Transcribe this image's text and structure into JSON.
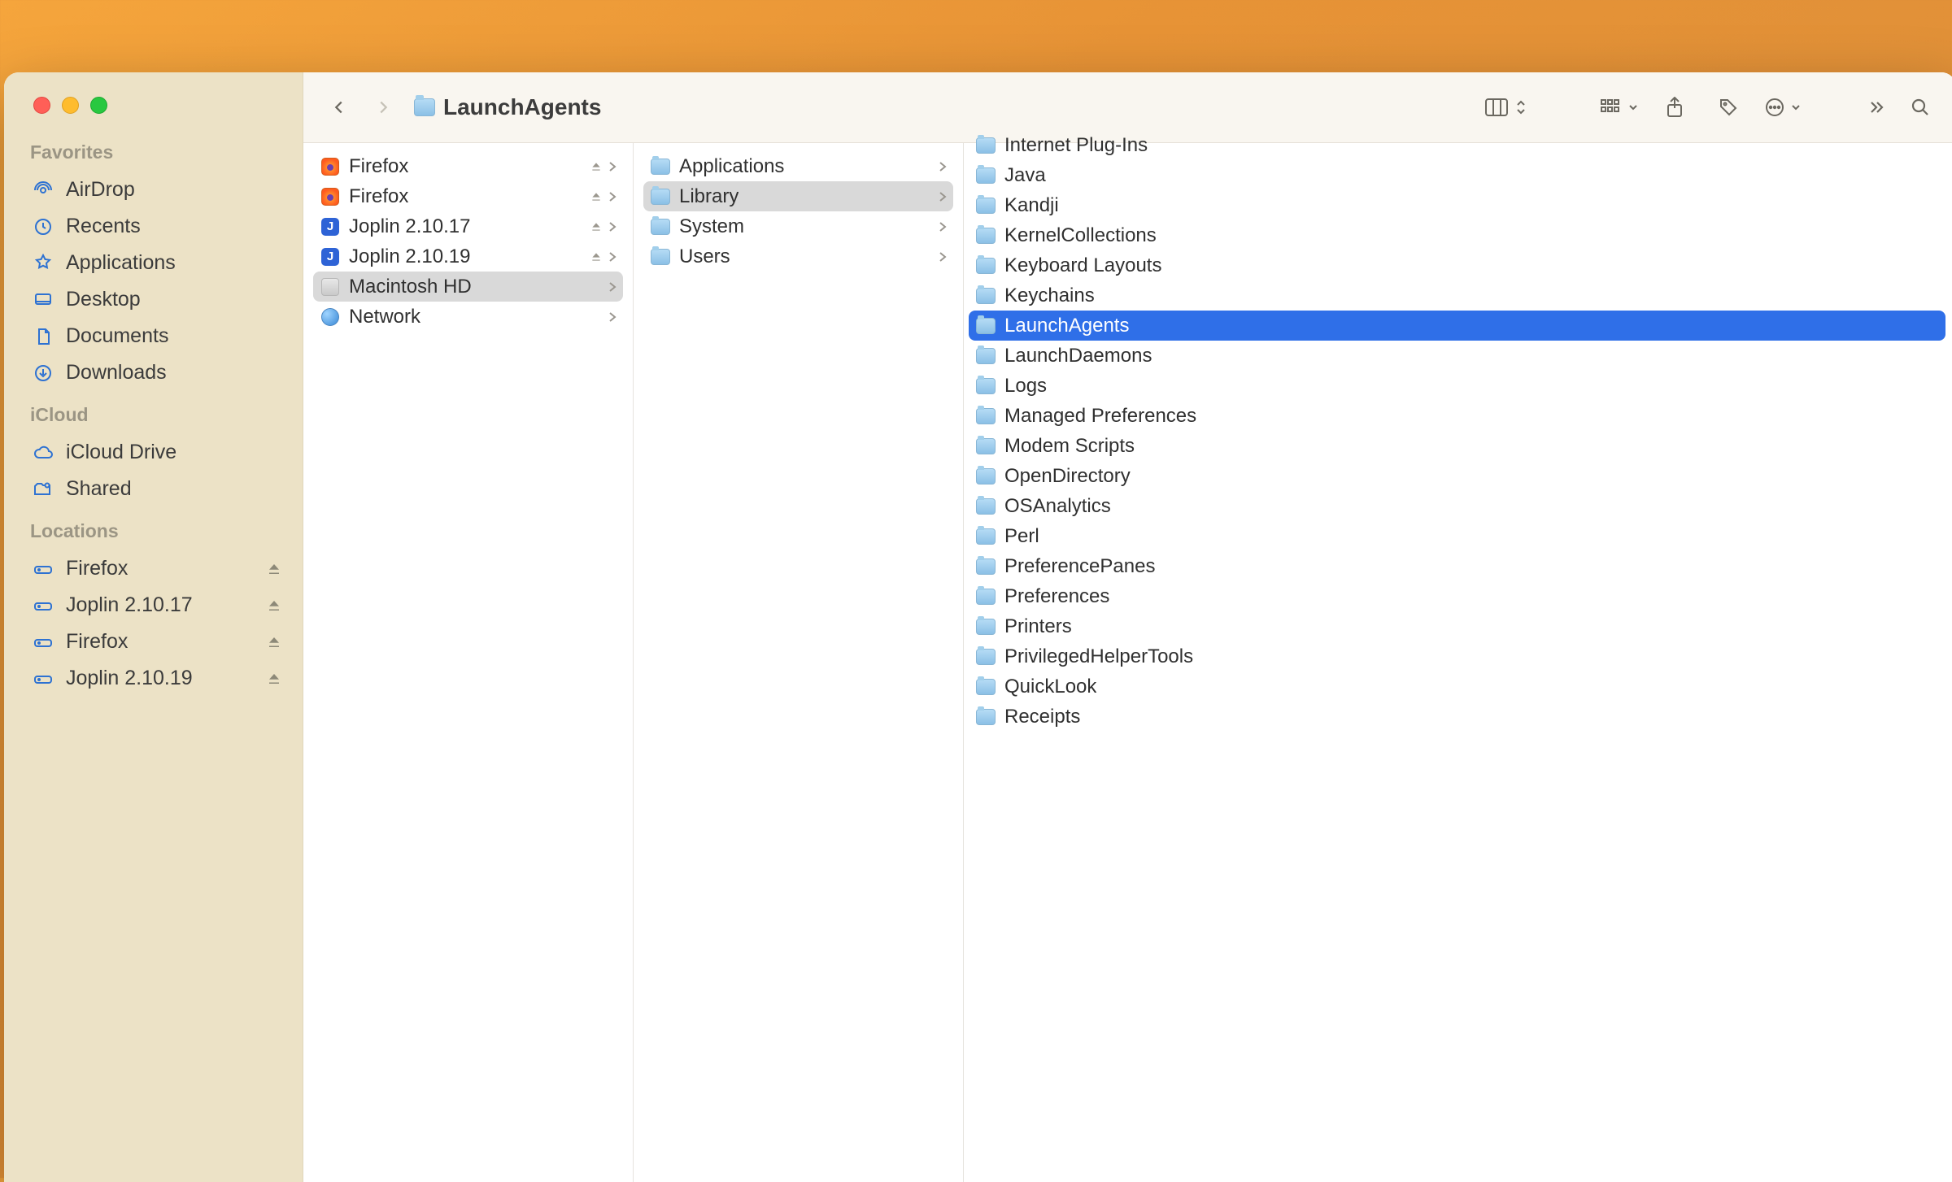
{
  "window_title": "LaunchAgents",
  "sidebar": {
    "sections": [
      {
        "title": "Favorites",
        "items": [
          {
            "label": "AirDrop",
            "icon": "airdrop"
          },
          {
            "label": "Recents",
            "icon": "clock"
          },
          {
            "label": "Applications",
            "icon": "apps"
          },
          {
            "label": "Desktop",
            "icon": "desktop"
          },
          {
            "label": "Documents",
            "icon": "document"
          },
          {
            "label": "Downloads",
            "icon": "download"
          }
        ]
      },
      {
        "title": "iCloud",
        "items": [
          {
            "label": "iCloud Drive",
            "icon": "cloud"
          },
          {
            "label": "Shared",
            "icon": "shared"
          }
        ]
      },
      {
        "title": "Locations",
        "items": [
          {
            "label": "Firefox",
            "icon": "drive",
            "eject": true
          },
          {
            "label": "Joplin 2.10.17",
            "icon": "drive",
            "eject": true
          },
          {
            "label": "Firefox",
            "icon": "drive",
            "eject": true
          },
          {
            "label": "Joplin 2.10.19",
            "icon": "drive",
            "eject": true
          }
        ]
      }
    ]
  },
  "columns": {
    "col1": [
      {
        "label": "Firefox",
        "kind": "firefox",
        "eject": true,
        "chev": true
      },
      {
        "label": "Firefox",
        "kind": "firefox",
        "eject": true,
        "chev": true
      },
      {
        "label": "Joplin 2.10.17",
        "kind": "joplin",
        "eject": true,
        "chev": true
      },
      {
        "label": "Joplin 2.10.19",
        "kind": "joplin",
        "eject": true,
        "chev": true
      },
      {
        "label": "Macintosh HD",
        "kind": "disk",
        "chev": true,
        "selected": true
      },
      {
        "label": "Network",
        "kind": "network",
        "chev": true
      }
    ],
    "col2": [
      {
        "label": "Applications",
        "kind": "folder",
        "chev": true
      },
      {
        "label": "Library",
        "kind": "folder",
        "chev": true,
        "selected": true
      },
      {
        "label": "System",
        "kind": "folder",
        "chev": true
      },
      {
        "label": "Users",
        "kind": "folder",
        "chev": true
      }
    ],
    "col3": [
      {
        "label": "Internet Plug-Ins",
        "kind": "folder",
        "partial_top": true
      },
      {
        "label": "Java",
        "kind": "folder"
      },
      {
        "label": "Kandji",
        "kind": "folder"
      },
      {
        "label": "KernelCollections",
        "kind": "folder"
      },
      {
        "label": "Keyboard Layouts",
        "kind": "folder"
      },
      {
        "label": "Keychains",
        "kind": "folder"
      },
      {
        "label": "LaunchAgents",
        "kind": "folder",
        "selected_blue": true
      },
      {
        "label": "LaunchDaemons",
        "kind": "folder"
      },
      {
        "label": "Logs",
        "kind": "folder"
      },
      {
        "label": "Managed Preferences",
        "kind": "folder"
      },
      {
        "label": "Modem Scripts",
        "kind": "folder"
      },
      {
        "label": "OpenDirectory",
        "kind": "folder"
      },
      {
        "label": "OSAnalytics",
        "kind": "folder"
      },
      {
        "label": "Perl",
        "kind": "folder"
      },
      {
        "label": "PreferencePanes",
        "kind": "folder"
      },
      {
        "label": "Preferences",
        "kind": "folder"
      },
      {
        "label": "Printers",
        "kind": "folder"
      },
      {
        "label": "PrivilegedHelperTools",
        "kind": "folder"
      },
      {
        "label": "QuickLook",
        "kind": "folder"
      },
      {
        "label": "Receipts",
        "kind": "folder"
      }
    ]
  }
}
